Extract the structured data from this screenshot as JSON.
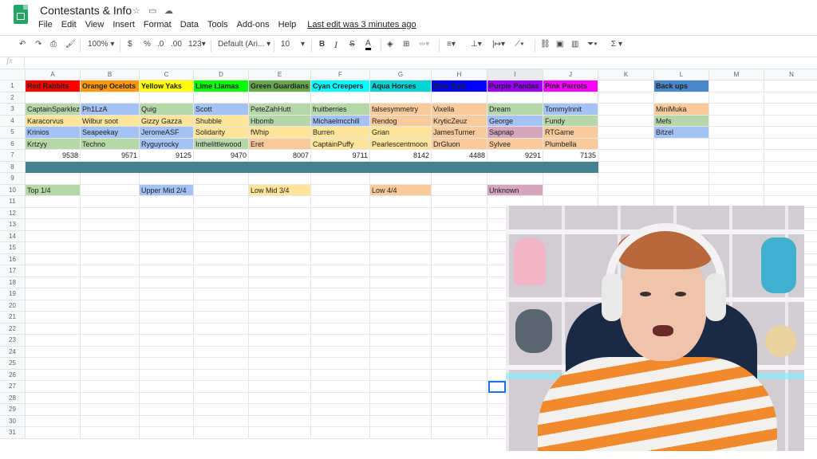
{
  "app": {
    "title": "Contestants & Info",
    "menus": [
      "File",
      "Edit",
      "View",
      "Insert",
      "Format",
      "Data",
      "Tools",
      "Add-ons",
      "Help"
    ],
    "last_edit": "Last edit was 3 minutes ago"
  },
  "toolbar": {
    "zoom": "100%",
    "currency": "$",
    "percent": "%",
    "dec_less": ".0",
    "dec_more": ".00",
    "format": "123",
    "font": "Default (Ari...",
    "font_size": "10",
    "bold": "B",
    "italic": "I",
    "strike": "S",
    "text_color": "A",
    "sum": "Σ"
  },
  "formula": {
    "fx": "fx",
    "value": ""
  },
  "columns": [
    "A",
    "B",
    "C",
    "D",
    "E",
    "F",
    "G",
    "H",
    "I",
    "J",
    "K",
    "L",
    "M",
    "N"
  ],
  "rows": [
    "1",
    "2",
    "3",
    "4",
    "5",
    "6",
    "7",
    "8",
    "9",
    "10",
    "11",
    "12",
    "13",
    "14",
    "15",
    "16",
    "17",
    "18",
    "19",
    "20",
    "21",
    "22",
    "23",
    "24",
    "25",
    "26",
    "27",
    "28",
    "29",
    "30",
    "31"
  ],
  "cells": [
    {
      "r": 1,
      "c": 0,
      "t": "Red Rabbits",
      "bg": "#ff0000",
      "b": true
    },
    {
      "r": 1,
      "c": 1,
      "t": "Orange Ocelots",
      "bg": "#ff9900",
      "b": true
    },
    {
      "r": 1,
      "c": 2,
      "t": "Yellow Yaks",
      "bg": "#ffff00",
      "b": true
    },
    {
      "r": 1,
      "c": 3,
      "t": "Lime Llamas",
      "bg": "#00ff00",
      "b": true
    },
    {
      "r": 1,
      "c": 4,
      "t": "Green Guardians",
      "bg": "#6aa84f",
      "b": true
    },
    {
      "r": 1,
      "c": 5,
      "t": "Cyan Creepers",
      "bg": "#00ffff",
      "b": true
    },
    {
      "r": 1,
      "c": 6,
      "t": "Aqua Horses",
      "bg": "#00d5d5",
      "b": true
    },
    {
      "r": 1,
      "c": 7,
      "t": "Blue Bats",
      "bg": "#0000ff",
      "b": true
    },
    {
      "r": 1,
      "c": 8,
      "t": "Purple Pandas",
      "bg": "#9900ff",
      "b": true
    },
    {
      "r": 1,
      "c": 9,
      "t": "Pink Parrots",
      "bg": "#ff00ff",
      "b": true
    },
    {
      "r": 1,
      "c": 11,
      "t": "Back ups",
      "bg": "#4a86c8",
      "b": true
    },
    {
      "r": 3,
      "c": 0,
      "t": "CaptainSparklez",
      "bg": "#b6d7a8"
    },
    {
      "r": 3,
      "c": 1,
      "t": "Ph1LzA",
      "bg": "#a4c2f4"
    },
    {
      "r": 3,
      "c": 2,
      "t": "Quig",
      "bg": "#b6d7a8"
    },
    {
      "r": 3,
      "c": 3,
      "t": "Scott",
      "bg": "#a4c2f4"
    },
    {
      "r": 3,
      "c": 4,
      "t": "PeteZahHutt",
      "bg": "#b6d7a8"
    },
    {
      "r": 3,
      "c": 5,
      "t": "fruitberries",
      "bg": "#b6d7a8"
    },
    {
      "r": 3,
      "c": 6,
      "t": "falsesymmetry",
      "bg": "#f9cb9c"
    },
    {
      "r": 3,
      "c": 7,
      "t": "Vixella",
      "bg": "#f9cb9c"
    },
    {
      "r": 3,
      "c": 8,
      "t": "Dream",
      "bg": "#b6d7a8"
    },
    {
      "r": 3,
      "c": 9,
      "t": "TommyInnit",
      "bg": "#a4c2f4"
    },
    {
      "r": 3,
      "c": 11,
      "t": "MiniMuka",
      "bg": "#f9cb9c"
    },
    {
      "r": 4,
      "c": 0,
      "t": "Karacorvus",
      "bg": "#ffe599"
    },
    {
      "r": 4,
      "c": 1,
      "t": "Wilbur soot",
      "bg": "#ffe599"
    },
    {
      "r": 4,
      "c": 2,
      "t": "Gizzy Gazza",
      "bg": "#ffe599"
    },
    {
      "r": 4,
      "c": 3,
      "t": "Shubble",
      "bg": "#ffe599"
    },
    {
      "r": 4,
      "c": 4,
      "t": "Hbomb",
      "bg": "#b6d7a8"
    },
    {
      "r": 4,
      "c": 5,
      "t": "Michaelmcchill",
      "bg": "#a4c2f4"
    },
    {
      "r": 4,
      "c": 6,
      "t": "Rendog",
      "bg": "#f9cb9c"
    },
    {
      "r": 4,
      "c": 7,
      "t": "KryticZeuz",
      "bg": "#f9cb9c"
    },
    {
      "r": 4,
      "c": 8,
      "t": "George",
      "bg": "#a4c2f4"
    },
    {
      "r": 4,
      "c": 9,
      "t": "Fundy",
      "bg": "#b6d7a8"
    },
    {
      "r": 4,
      "c": 11,
      "t": "Mefs",
      "bg": "#b6d7a8"
    },
    {
      "r": 5,
      "c": 0,
      "t": "Krinios",
      "bg": "#a4c2f4"
    },
    {
      "r": 5,
      "c": 1,
      "t": "Seapeekay",
      "bg": "#a4c2f4"
    },
    {
      "r": 5,
      "c": 2,
      "t": "JeromeASF",
      "bg": "#a4c2f4"
    },
    {
      "r": 5,
      "c": 3,
      "t": "Solidarity",
      "bg": "#ffe599"
    },
    {
      "r": 5,
      "c": 4,
      "t": "fWhip",
      "bg": "#ffe599"
    },
    {
      "r": 5,
      "c": 5,
      "t": "Burren",
      "bg": "#ffe599"
    },
    {
      "r": 5,
      "c": 6,
      "t": "Grian",
      "bg": "#ffe599"
    },
    {
      "r": 5,
      "c": 7,
      "t": "JamesTurner",
      "bg": "#f9cb9c"
    },
    {
      "r": 5,
      "c": 8,
      "t": "Sapnap",
      "bg": "#d5a6bd"
    },
    {
      "r": 5,
      "c": 9,
      "t": "RTGame",
      "bg": "#f9cb9c"
    },
    {
      "r": 5,
      "c": 11,
      "t": "Bitzel",
      "bg": "#a4c2f4"
    },
    {
      "r": 6,
      "c": 0,
      "t": "Krtzyy",
      "bg": "#b6d7a8"
    },
    {
      "r": 6,
      "c": 1,
      "t": "Techno",
      "bg": "#b6d7a8"
    },
    {
      "r": 6,
      "c": 2,
      "t": "Ryguyrocky",
      "bg": "#a4c2f4"
    },
    {
      "r": 6,
      "c": 3,
      "t": "Inthelittlewood",
      "bg": "#b6d7a8"
    },
    {
      "r": 6,
      "c": 4,
      "t": "Eret",
      "bg": "#f9cb9c"
    },
    {
      "r": 6,
      "c": 5,
      "t": "CaptainPuffy",
      "bg": "#ffe599"
    },
    {
      "r": 6,
      "c": 6,
      "t": "Pearlescentmoon",
      "bg": "#ffe599"
    },
    {
      "r": 6,
      "c": 7,
      "t": "DrGluon",
      "bg": "#f9cb9c"
    },
    {
      "r": 6,
      "c": 8,
      "t": "Sylvee",
      "bg": "#f9cb9c"
    },
    {
      "r": 6,
      "c": 9,
      "t": "Plumbella",
      "bg": "#f9cb9c"
    },
    {
      "r": 7,
      "c": 0,
      "t": "9538",
      "n": true
    },
    {
      "r": 7,
      "c": 1,
      "t": "9571",
      "n": true
    },
    {
      "r": 7,
      "c": 2,
      "t": "9125",
      "n": true
    },
    {
      "r": 7,
      "c": 3,
      "t": "9470",
      "n": true
    },
    {
      "r": 7,
      "c": 4,
      "t": "8007",
      "n": true
    },
    {
      "r": 7,
      "c": 5,
      "t": "9711",
      "n": true
    },
    {
      "r": 7,
      "c": 6,
      "t": "8142",
      "n": true
    },
    {
      "r": 7,
      "c": 7,
      "t": "4488",
      "n": true
    },
    {
      "r": 7,
      "c": 8,
      "t": "9291",
      "n": true
    },
    {
      "r": 7,
      "c": 9,
      "t": "7135",
      "n": true
    },
    {
      "r": 10,
      "c": 0,
      "t": "Top 1/4",
      "bg": "#b6d7a8"
    },
    {
      "r": 10,
      "c": 2,
      "t": "Upper Mid 2/4",
      "bg": "#a4c2f4"
    },
    {
      "r": 10,
      "c": 4,
      "t": "Low Mid 3/4",
      "bg": "#ffe599"
    },
    {
      "r": 10,
      "c": 6,
      "t": "Low 4/4",
      "bg": "#f9cb9c"
    },
    {
      "r": 10,
      "c": 8,
      "t": "Unknown",
      "bg": "#d5a6bd"
    }
  ],
  "colors": {
    "divider_row": "#45818e",
    "selection": "#1a73e8"
  }
}
